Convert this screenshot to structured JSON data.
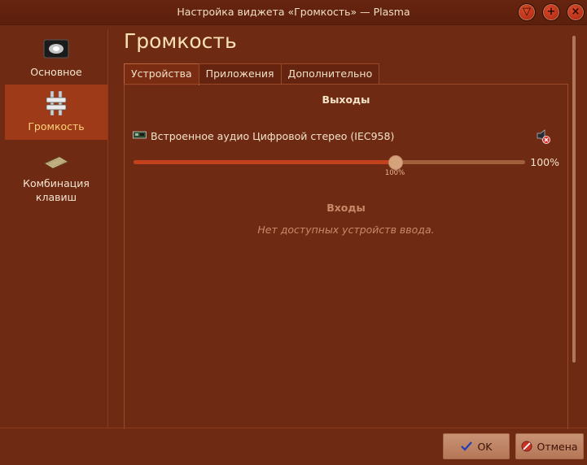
{
  "window": {
    "title": "Настройка виджета «Громкость» — Plasma"
  },
  "titlebar_buttons": [
    {
      "icon": "minimize-triangle-icon",
      "glyph": "▽"
    },
    {
      "icon": "maximize-plus-icon",
      "glyph": "+"
    },
    {
      "icon": "close-x-icon",
      "glyph": "×"
    }
  ],
  "sidebar": {
    "items": [
      {
        "label": "Основное",
        "icon": "general-settings-icon",
        "active": false
      },
      {
        "label": "Громкость",
        "icon": "volume-mixer-icon",
        "active": true
      },
      {
        "label": "Комбинация клавиш",
        "icon": "keyboard-icon",
        "active": false
      }
    ]
  },
  "page": {
    "title": "Громкость"
  },
  "tabs": [
    {
      "label": "Устройства",
      "active": true
    },
    {
      "label": "Приложения",
      "active": false
    },
    {
      "label": "Дополнительно",
      "active": false
    }
  ],
  "outputs": {
    "heading": "Выходы",
    "device": {
      "name": "Встроенное аудио Цифровой стерео (IEC958)",
      "icon": "audio-card-icon",
      "mute_icon": "speaker-muted-icon",
      "volume_percent": 100,
      "volume_label": "100%",
      "slider_tick_label": "100%",
      "slider_max_percent": 150
    }
  },
  "inputs": {
    "heading": "Входы",
    "empty_text": "Нет доступных устройств ввода."
  },
  "buttons": {
    "ok_label": "OK",
    "cancel_label": "Отмена"
  },
  "colors": {
    "background": "#6f2a14",
    "accent": "#c3421d",
    "active_item": "#9e3a17",
    "active_text": "#ffd27a"
  }
}
